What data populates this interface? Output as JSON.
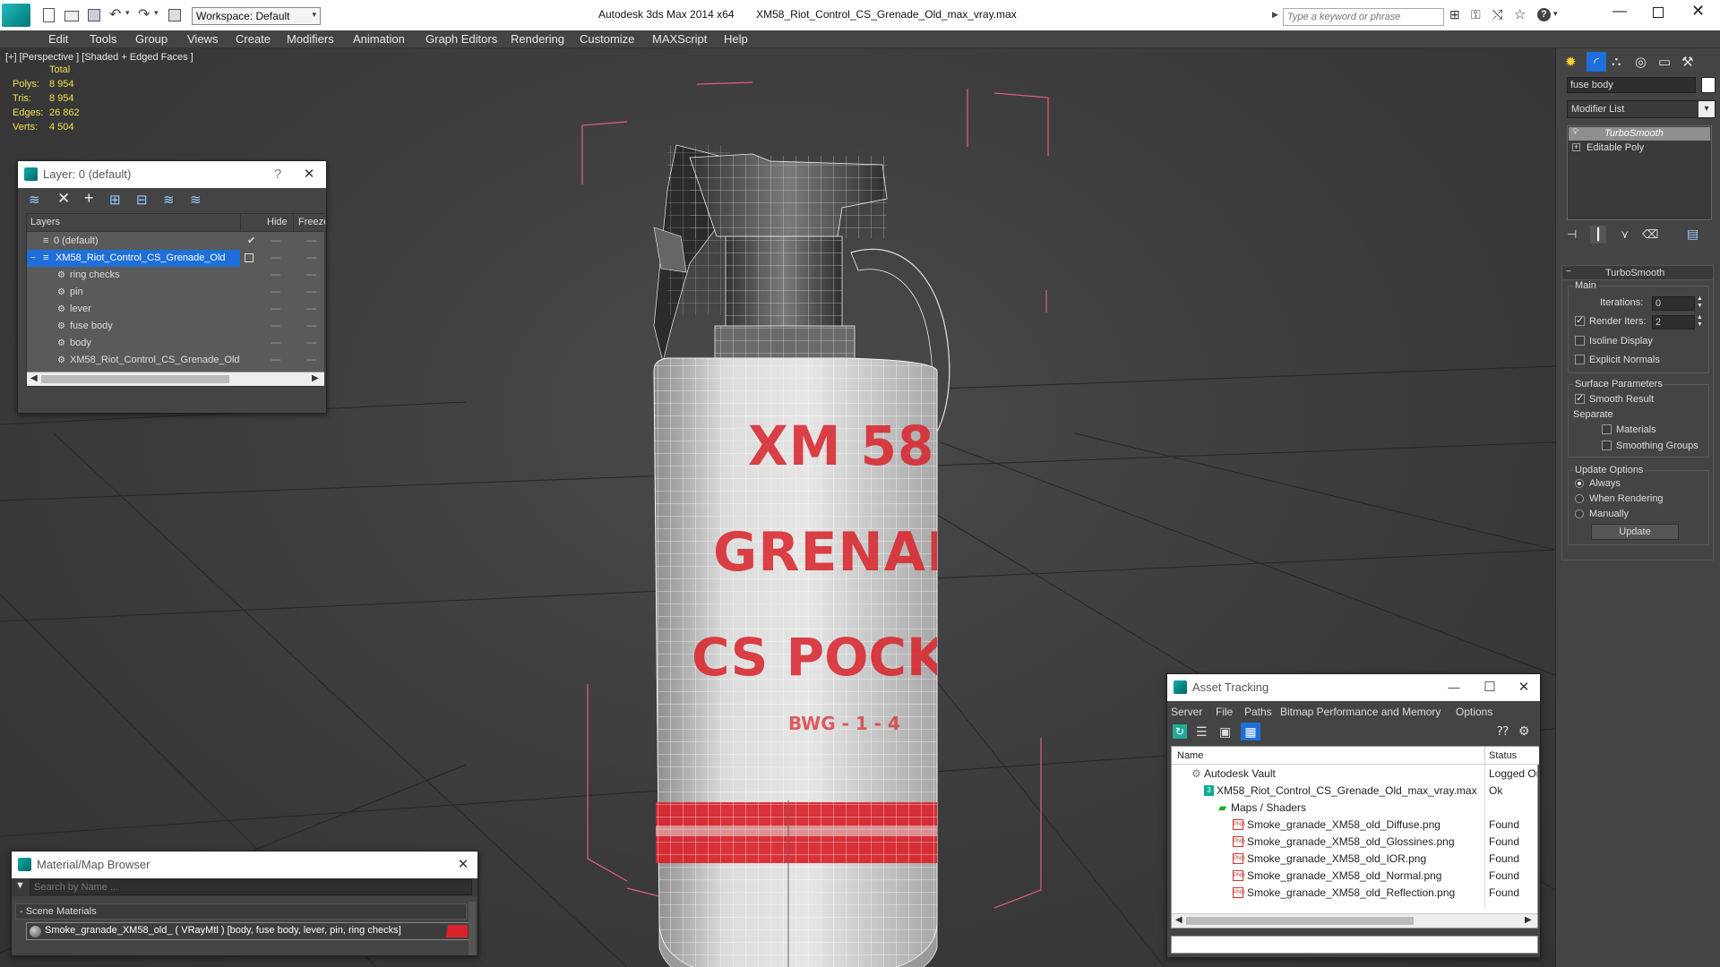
{
  "titlebar": {
    "app": "Autodesk 3ds Max  2014 x64",
    "file": "XM58_Riot_Control_CS_Grenade_Old_max_vray.max",
    "workspace": "Workspace: Default",
    "search_placeholder": "Type a keyword or phrase"
  },
  "menu": [
    "Edit",
    "Tools",
    "Group",
    "Views",
    "Create",
    "Modifiers",
    "Animation",
    "Graph Editors",
    "Rendering",
    "Customize",
    "MAXScript",
    "Help"
  ],
  "viewport": {
    "label": "[+] [Perspective ] [Shaded + Edged Faces ]",
    "stats": {
      "header": "Total",
      "rows": [
        {
          "label": "Polys:",
          "value": "8 954"
        },
        {
          "label": "Tris:",
          "value": "8 954"
        },
        {
          "label": "Edges:",
          "value": "26 862"
        },
        {
          "label": "Verts:",
          "value": "4 504"
        }
      ]
    },
    "grenade_text": {
      "line1": "XM 58",
      "line2": "GRENADE",
      "line3": "CS POCKET",
      "line4": "BWG - 1 - 4"
    }
  },
  "layer_panel": {
    "title": "Layer: 0 (default)",
    "help": "?",
    "col_layers": "Layers",
    "col_hide": "Hide",
    "col_freeze": "Freeze",
    "rows": [
      {
        "label": "0 (default)",
        "selected": false,
        "indent": 0
      },
      {
        "label": "XM58_Riot_Control_CS_Grenade_Old",
        "selected": true,
        "indent": 0
      },
      {
        "label": "ring checks",
        "selected": false,
        "indent": 1
      },
      {
        "label": "pin",
        "selected": false,
        "indent": 1
      },
      {
        "label": "lever",
        "selected": false,
        "indent": 1
      },
      {
        "label": "fuse body",
        "selected": false,
        "indent": 1
      },
      {
        "label": "body",
        "selected": false,
        "indent": 1
      },
      {
        "label": "XM58_Riot_Control_CS_Grenade_Old",
        "selected": false,
        "indent": 1
      }
    ],
    "dash": "----"
  },
  "material_browser": {
    "title": "Material/Map Browser",
    "search_placeholder": "Search by Name ...",
    "section": "- Scene Materials",
    "item": "Smoke_granade_XM58_old_  ( VRayMtl ) [body, fuse body, lever, pin, ring checks]"
  },
  "asset_tracking": {
    "title": "Asset Tracking",
    "menu": [
      "Server",
      "File",
      "Paths",
      "Bitmap Performance and Memory",
      "Options"
    ],
    "col_name": "Name",
    "col_status": "Status",
    "rows": [
      {
        "name": "Autodesk Vault",
        "status": "Logged Ou",
        "indent": 1
      },
      {
        "name": "XM58_Riot_Control_CS_Grenade_Old_max_vray.max",
        "status": "Ok",
        "indent": 2
      },
      {
        "name": "Maps / Shaders",
        "status": "",
        "indent": 3
      },
      {
        "name": "Smoke_granade_XM58_old_Diffuse.png",
        "status": "Found",
        "indent": 4
      },
      {
        "name": "Smoke_granade_XM58_old_Glossines.png",
        "status": "Found",
        "indent": 4
      },
      {
        "name": "Smoke_granade_XM58_old_IOR.png",
        "status": "Found",
        "indent": 4
      },
      {
        "name": "Smoke_granade_XM58_old_Normal.png",
        "status": "Found",
        "indent": 4
      },
      {
        "name": "Smoke_granade_XM58_old_Reflection.png",
        "status": "Found",
        "indent": 4
      }
    ]
  },
  "command_panel": {
    "object_name": "fuse body",
    "modifier_list": "Modifier List",
    "stack": [
      "TurboSmooth",
      "Editable Poly"
    ],
    "rollout_title": "TurboSmooth",
    "main_group": "Main",
    "iterations_label": "Iterations:",
    "iterations_value": "0",
    "render_iters_label": "Render Iters:",
    "render_iters_value": "2",
    "isoline_label": "Isoline Display",
    "explicit_label": "Explicit Normals",
    "surface_group": "Surface Parameters",
    "smooth_result_label": "Smooth Result",
    "separate_label": "Separate",
    "materials_label": "Materials",
    "smoothing_groups_label": "Smoothing Groups",
    "update_group": "Update Options",
    "always_label": "Always",
    "when_rendering_label": "When Rendering",
    "manually_label": "Manually",
    "update_button": "Update"
  },
  "colors": {
    "selection": "#1e6fd9",
    "accent_red": "#d8232a",
    "bbox": "#e0607a",
    "stat_yellow": "#f0e050"
  }
}
